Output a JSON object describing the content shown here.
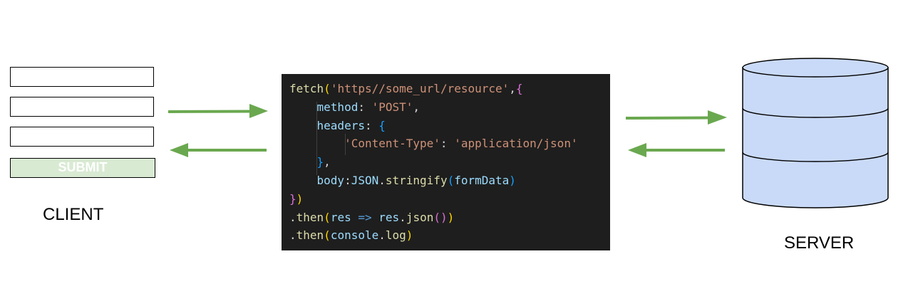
{
  "client": {
    "label": "CLIENT",
    "fields": [
      {
        "value": ""
      },
      {
        "value": ""
      },
      {
        "value": ""
      }
    ],
    "submit_label": "SUBMIT"
  },
  "server": {
    "label": "SERVER"
  },
  "code": {
    "lines": [
      [
        {
          "t": "fetch",
          "c": "fn"
        },
        {
          "t": "(",
          "c": "p1"
        },
        {
          "t": "'https//some_url/resource'",
          "c": "str"
        },
        {
          "t": ",",
          "c": "plain"
        },
        {
          "t": "{",
          "c": "p2"
        }
      ],
      [
        {
          "t": "    ",
          "c": "plain"
        },
        {
          "t": "method",
          "c": "prop"
        },
        {
          "t": ": ",
          "c": "plain"
        },
        {
          "t": "'POST'",
          "c": "str"
        },
        {
          "t": ",",
          "c": "plain"
        }
      ],
      [
        {
          "t": "    ",
          "c": "plain"
        },
        {
          "t": "headers",
          "c": "prop"
        },
        {
          "t": ": ",
          "c": "plain"
        },
        {
          "t": "{",
          "c": "p3"
        }
      ],
      [
        {
          "t": "        ",
          "c": "plain"
        },
        {
          "t": "'Content-Type'",
          "c": "str"
        },
        {
          "t": ": ",
          "c": "plain"
        },
        {
          "t": "'application/json'",
          "c": "str"
        }
      ],
      [
        {
          "t": "    ",
          "c": "plain"
        },
        {
          "t": "}",
          "c": "p3"
        },
        {
          "t": ",",
          "c": "plain"
        }
      ],
      [
        {
          "t": "    ",
          "c": "plain"
        },
        {
          "t": "body",
          "c": "prop"
        },
        {
          "t": ":",
          "c": "plain"
        },
        {
          "t": "JSON",
          "c": "prop"
        },
        {
          "t": ".",
          "c": "plain"
        },
        {
          "t": "stringify",
          "c": "fn"
        },
        {
          "t": "(",
          "c": "p3"
        },
        {
          "t": "formData",
          "c": "prop"
        },
        {
          "t": ")",
          "c": "p3"
        }
      ],
      [
        {
          "t": "}",
          "c": "p2"
        },
        {
          "t": ")",
          "c": "p1"
        }
      ],
      [
        {
          "t": ".",
          "c": "plain"
        },
        {
          "t": "then",
          "c": "fn"
        },
        {
          "t": "(",
          "c": "p1"
        },
        {
          "t": "res",
          "c": "prop"
        },
        {
          "t": " ",
          "c": "plain"
        },
        {
          "t": "=>",
          "c": "kw"
        },
        {
          "t": " ",
          "c": "plain"
        },
        {
          "t": "res",
          "c": "prop"
        },
        {
          "t": ".",
          "c": "plain"
        },
        {
          "t": "json",
          "c": "fn"
        },
        {
          "t": "()",
          "c": "p2"
        },
        {
          "t": ")",
          "c": "p1"
        }
      ],
      [
        {
          "t": ".",
          "c": "plain"
        },
        {
          "t": "then",
          "c": "fn"
        },
        {
          "t": "(",
          "c": "p1"
        },
        {
          "t": "console",
          "c": "prop"
        },
        {
          "t": ".",
          "c": "plain"
        },
        {
          "t": "log",
          "c": "fn"
        },
        {
          "t": ")",
          "c": "p1"
        }
      ]
    ]
  },
  "colors": {
    "arrow": "#6aa84f",
    "submit_fill": "#d9ead3",
    "code_bg": "#1e1e1e",
    "cylinder_fill": "#c9daf8",
    "syntax": {
      "fn": "#dcdcaa",
      "str": "#ce9178",
      "prop": "#9cdcfe",
      "kw": "#569cd6",
      "plain": "#d4d4d4",
      "p1": "#ffd700",
      "p2": "#da70d6",
      "p3": "#179fff"
    }
  }
}
